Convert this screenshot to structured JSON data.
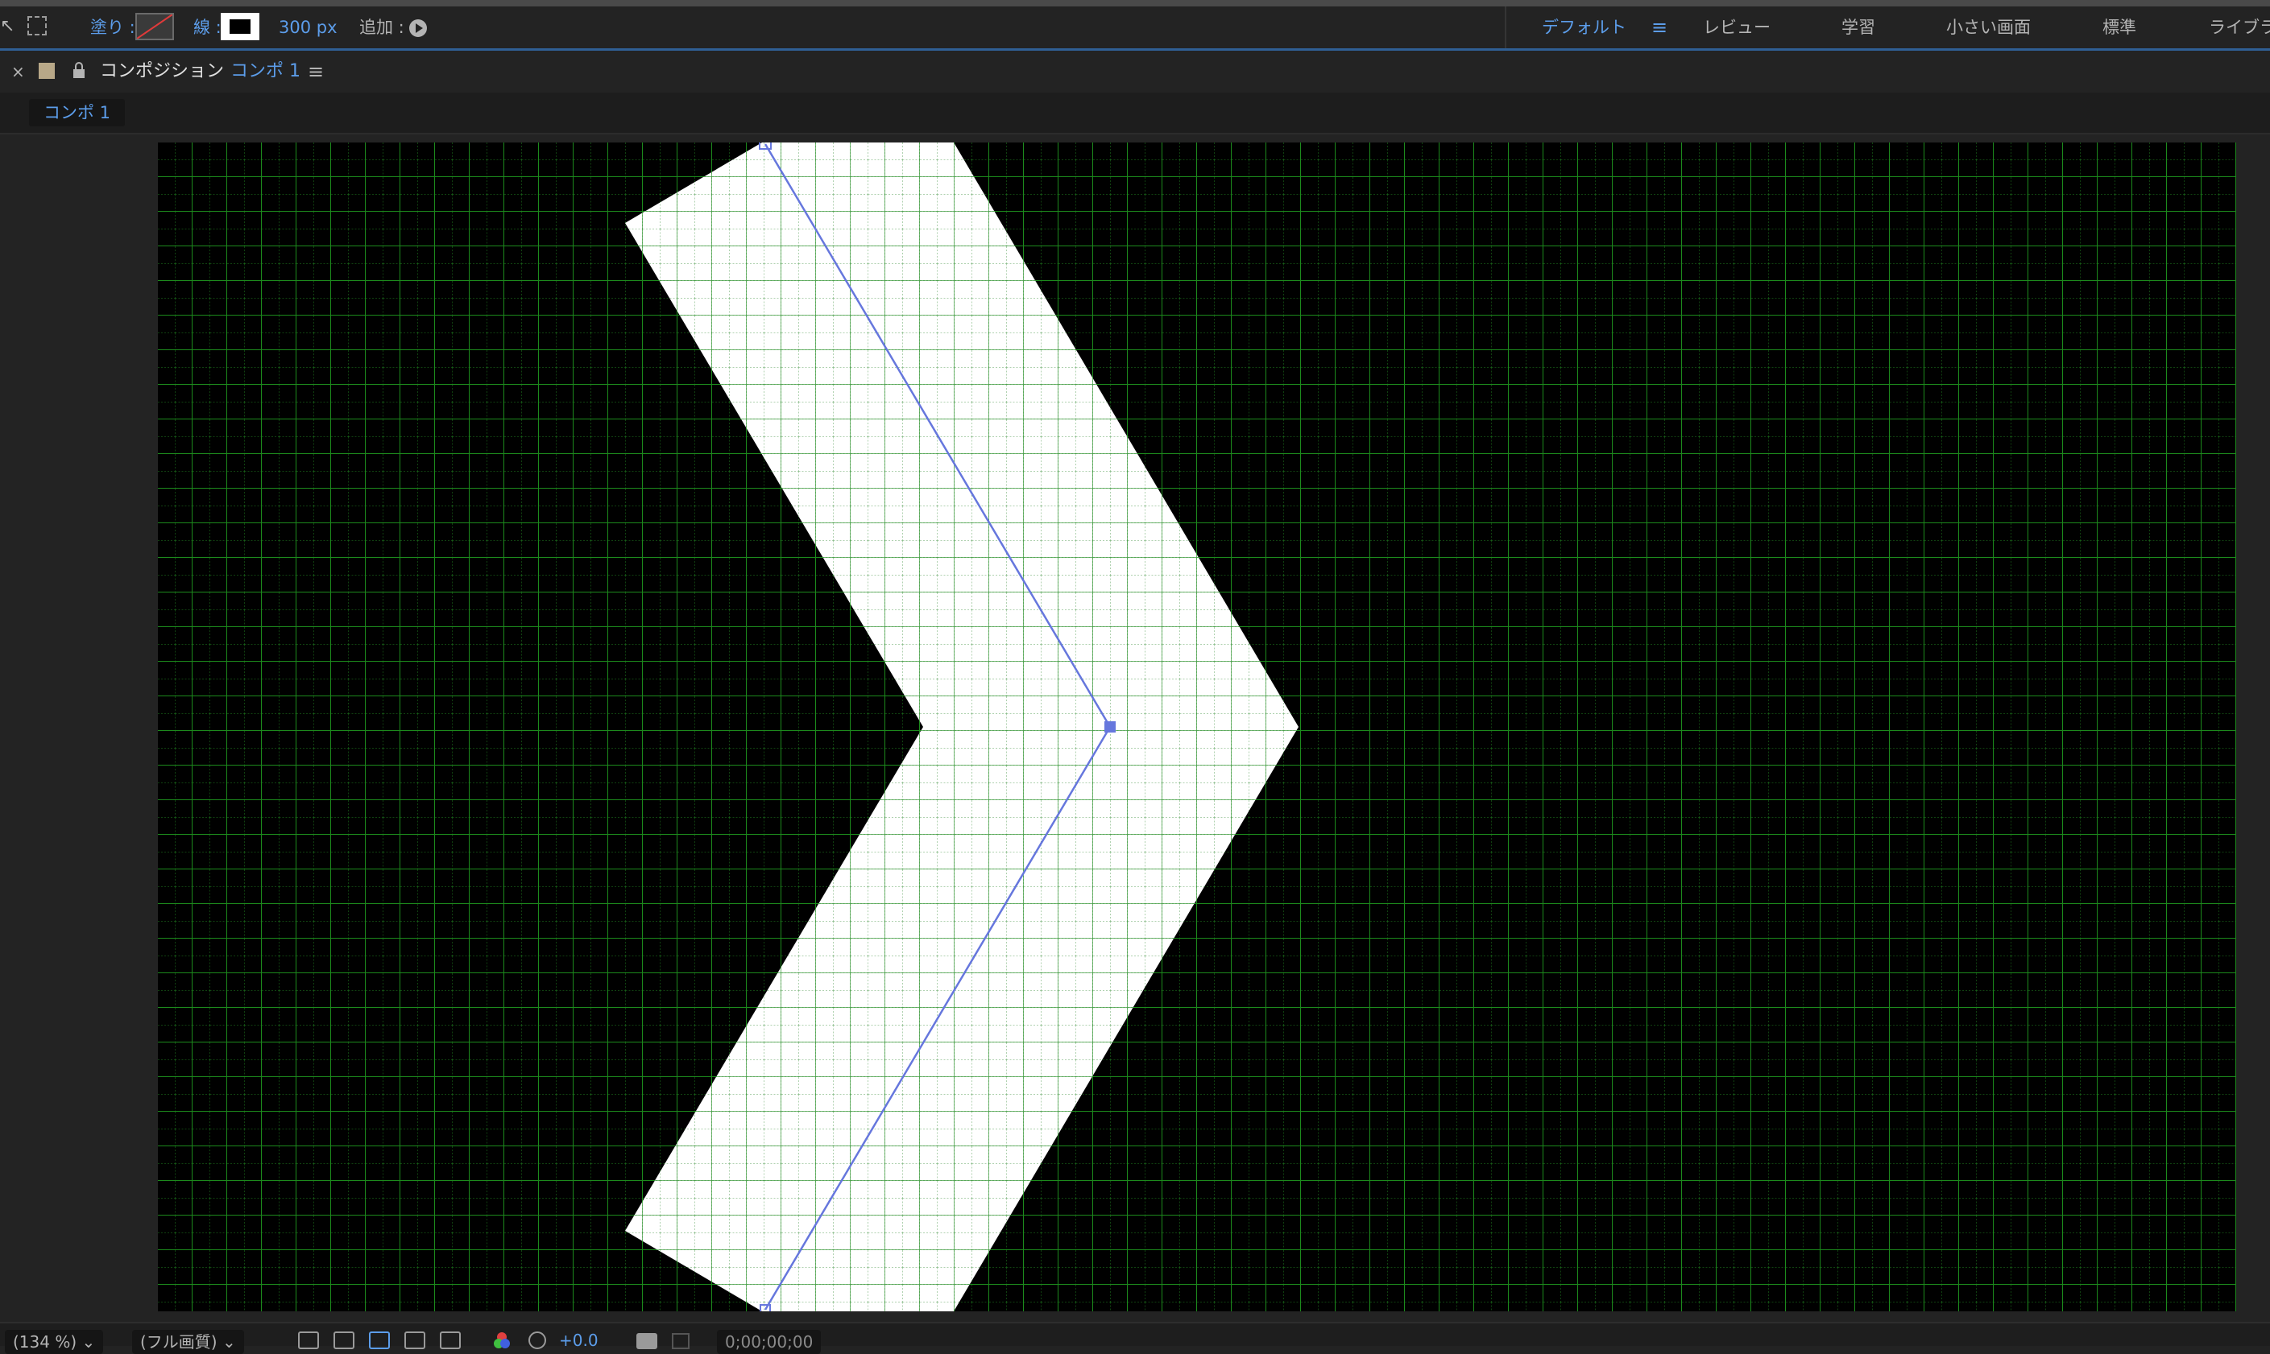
{
  "toolbar": {
    "fill_label": "塗り :",
    "stroke_label": "線 :",
    "stroke_width": "300 px",
    "add_label": "追加 :",
    "workspaces": [
      "デフォルト",
      "レビュー",
      "学習",
      "小さい画面",
      "標準",
      "ライブラ"
    ],
    "workspace_menu_icon": "hamburger-icon",
    "colors": {
      "accent": "#5c9dea",
      "fill_none_slash": "#e03a3a"
    }
  },
  "panel": {
    "close": "×",
    "title": "コンポジション",
    "comp_name": "コンポ 1",
    "menu_icon": "hamburger-icon",
    "tab_label": "コンポ 1"
  },
  "viewer": {
    "background": "#000000",
    "grid_color": "#1c7a1c",
    "shape_fill": "#ffffff",
    "path_color": "#6677dd"
  },
  "bottom": {
    "zoom": "(134 %)",
    "resolution": "(フル画質)",
    "exposure": "+0.0",
    "timecode": "0;00;00;00"
  }
}
